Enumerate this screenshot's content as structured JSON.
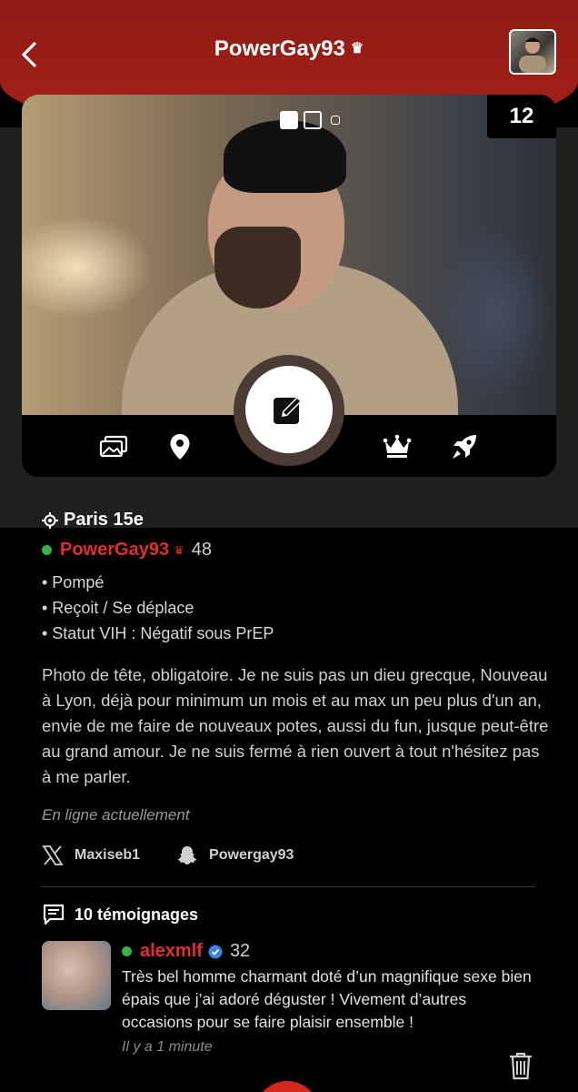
{
  "header": {
    "title": "PowerGay93",
    "crown_glyph": "♛",
    "back_icon": "chevron-left-icon",
    "accent_color": "#a6221a"
  },
  "photo": {
    "count": "12",
    "page_indicator": {
      "total": 3,
      "active": 1
    }
  },
  "actions": [
    {
      "icon": "photos-icon"
    },
    {
      "icon": "location-pin-icon"
    },
    {
      "icon": "edit-icon"
    },
    {
      "icon": "crown-icon"
    },
    {
      "icon": "rocket-icon"
    }
  ],
  "profile": {
    "location": "Paris 15e",
    "username": "PowerGay93",
    "crown_glyph": "♛",
    "age": "48",
    "online": true,
    "bullets": [
      "• Pompé",
      "• Reçoit / Se déplace",
      "• Statut VIH : Négatif sous PrEP"
    ],
    "bio": "Photo de tête, obligatoire. Je ne suis pas un dieu grecque, Nouveau à Lyon, déjà pour minimum un mois et au max un peu plus d'un an, envie de me faire de nouveaux potes, aussi du fun, jusque peut-être au grand amour. Je ne suis fermé à rien ouvert à tout n'hésitez pas à me parler.",
    "status": "En ligne actuellement",
    "socials": [
      {
        "icon": "x-icon",
        "handle": "Maxiseb1"
      },
      {
        "icon": "snapchat-icon",
        "handle": "Powergay93"
      }
    ]
  },
  "testimonials": {
    "header": "10 témoignages",
    "items": [
      {
        "username": "alexmlf",
        "verified": true,
        "age": "32",
        "text": "Très bel homme charmant doté d’un magnifique sexe bien épais que j’ai adoré déguster ! Vivement d’autres occasions pour se faire plaisir ensemble !",
        "time": "Il y a 1 minute"
      }
    ]
  }
}
